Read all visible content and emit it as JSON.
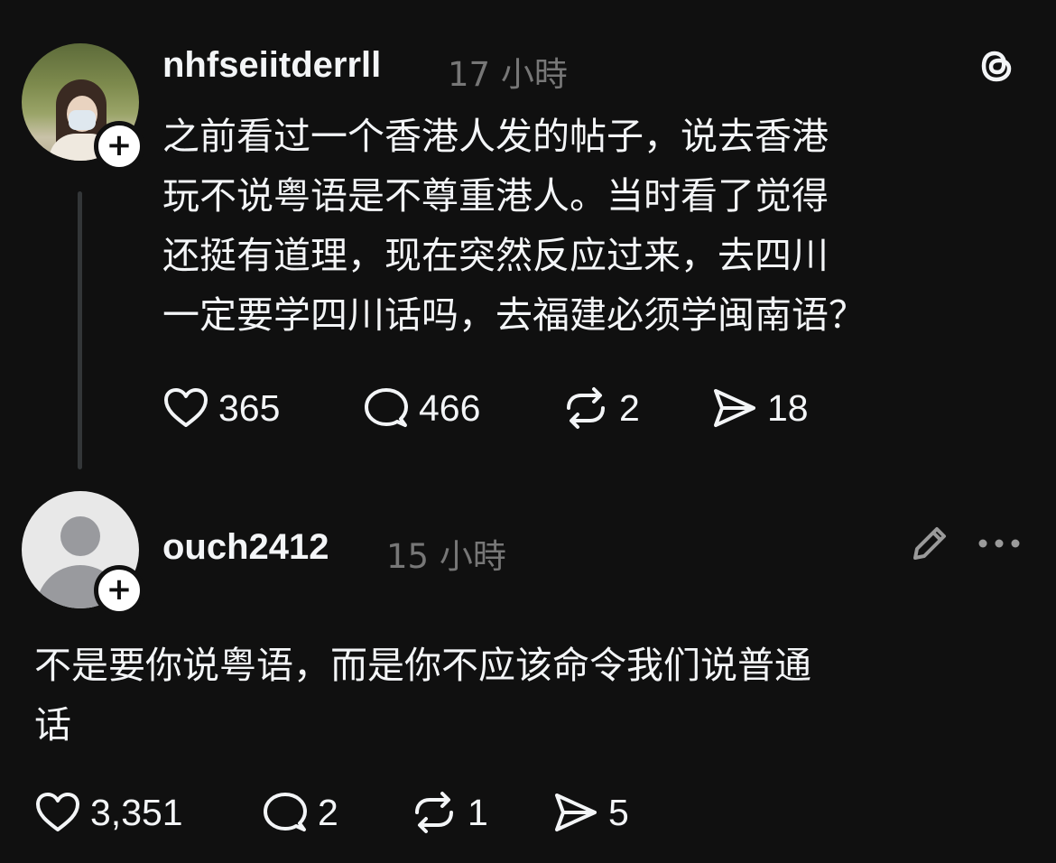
{
  "post": {
    "username": "nhfseiitderrll",
    "time": "17 小時",
    "text_lines": [
      "之前看过一个香港人发的帖子，说去香港",
      "玩不说粤语是不尊重港人。当时看了觉得",
      "还挺有道理，现在突然反应过来，去四川",
      "一定要学四川话吗，去福建必须学闽南语？"
    ],
    "likes": "365",
    "replies": "466",
    "reposts": "2",
    "shares": "18"
  },
  "reply": {
    "username": "ouch2412",
    "time": "15 小時",
    "text_lines": [
      "不是要你说粤语，而是你不应该命令我们说普通",
      "话"
    ],
    "likes": "3,351",
    "replies": "2",
    "reposts": "1",
    "shares": "5"
  },
  "icons": {
    "brand": "threads-logo-icon",
    "edit": "pencil-icon",
    "more": "more-dots-icon",
    "like": "heart-icon",
    "reply": "comment-icon",
    "repost": "repost-icon",
    "share": "send-icon",
    "follow": "plus-icon"
  },
  "colors": {
    "background": "#101010",
    "text": "#f3f5f7",
    "muted": "#777777",
    "thread_line": "#333638"
  }
}
